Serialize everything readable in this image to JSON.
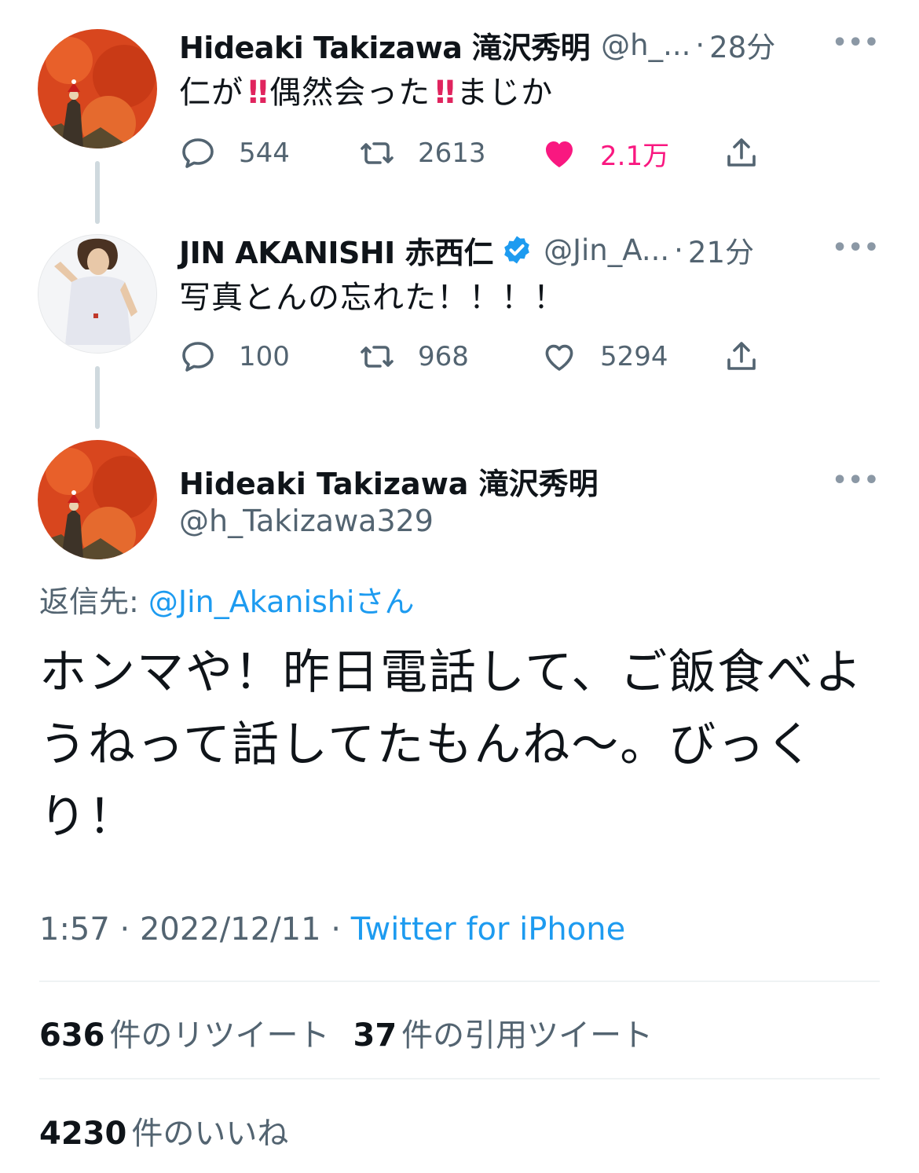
{
  "tweets": [
    {
      "name": "Hideaki Takizawa 滝沢秀明",
      "handle": "@h_...",
      "dot": "·",
      "time": "28分",
      "text_a": "仁が",
      "bang": "‼",
      "text_b": "偶然会った",
      "text_c": "まじか",
      "replies": "544",
      "retweets": "2613",
      "likes": "2.1万",
      "liked": true
    },
    {
      "name": "JIN AKANISHI 赤西仁",
      "handle": "@Jin_A...",
      "dot": "·",
      "time": "21分",
      "text": "写真とんの忘れた！！！！",
      "replies": "100",
      "retweets": "968",
      "likes": "5294",
      "liked": false,
      "verified": true
    }
  ],
  "main": {
    "name": "Hideaki Takizawa 滝沢秀明",
    "handle": "@h_Takizawa329",
    "reply_prefix": "返信先: ",
    "reply_mention": "@Jin_Akanishi",
    "reply_suffix": "さん",
    "body": "ホンマや！昨日電話して、ご飯食べようねって話してたもんね〜。びっくり！",
    "time": "1:57",
    "date": "2022/12/11",
    "sep": " · ",
    "source": "Twitter for iPhone",
    "retweet_count": "636",
    "retweet_label": "件のリツイート",
    "quote_count": "37",
    "quote_label": "件の引用ツイート",
    "like_count": "4230",
    "like_label": "件のいいね"
  },
  "more_label": "•••",
  "colors": {
    "accent": "#1d9bf0",
    "like": "#f91880",
    "muted": "#536471",
    "text": "#0f1419"
  },
  "icons": [
    "reply-icon",
    "retweet-icon",
    "like-icon",
    "share-icon",
    "verified-badge-icon",
    "more-icon"
  ]
}
